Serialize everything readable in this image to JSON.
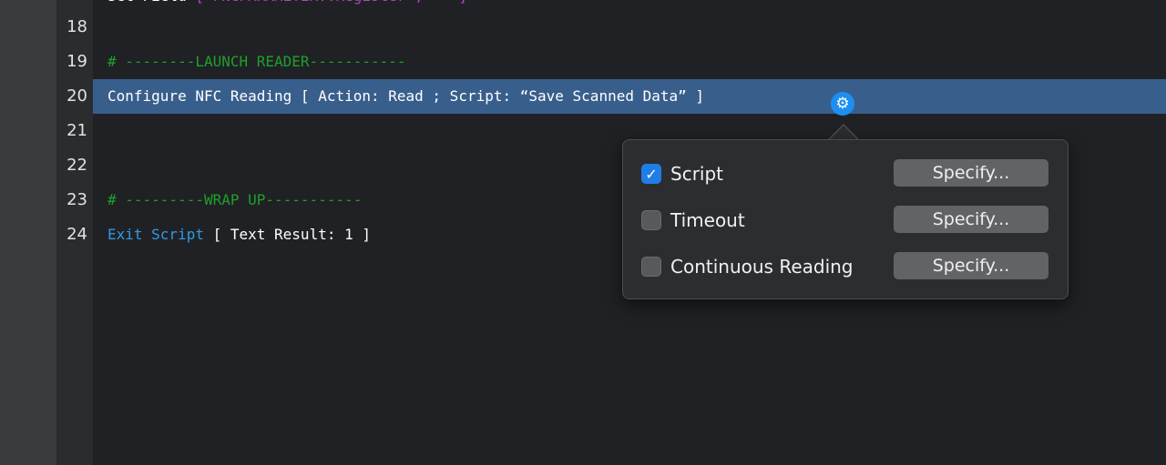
{
  "editor": {
    "lines": [
      {
        "number": "18",
        "parts": []
      },
      {
        "number": "19",
        "parts": [
          {
            "text": "# --------LAUNCH READER-----------",
            "cls": "c-comment"
          }
        ]
      },
      {
        "number": "20",
        "selected": true,
        "parts": [
          {
            "text": "Configure NFC Reading [ Action: Read ; Script: “Save Scanned Data” ]",
            "cls": "c-plain"
          }
        ]
      },
      {
        "number": "21",
        "parts": []
      },
      {
        "number": "22",
        "parts": []
      },
      {
        "number": "23",
        "parts": [
          {
            "text": "# ---------WRAP UP-----------",
            "cls": "c-comment"
          }
        ]
      },
      {
        "number": "24",
        "parts": [
          {
            "text": "Exit Script",
            "cls": "c-step"
          },
          {
            "text": " [ Text Result: 1 ]",
            "cls": "c-plain"
          }
        ]
      }
    ]
  },
  "gear_icon": "gear-icon",
  "popover": {
    "options": [
      {
        "label": "Script",
        "checked": true,
        "button": "Specify..."
      },
      {
        "label": "Timeout",
        "checked": false,
        "button": "Specify..."
      },
      {
        "label": "Continuous Reading",
        "checked": false,
        "button": "Specify..."
      }
    ]
  },
  "colors": {
    "selection": "#385f8c",
    "comment": "#1ea02a",
    "step_keyword": "#2f9ae6",
    "accent": "#1d8ff0"
  }
}
